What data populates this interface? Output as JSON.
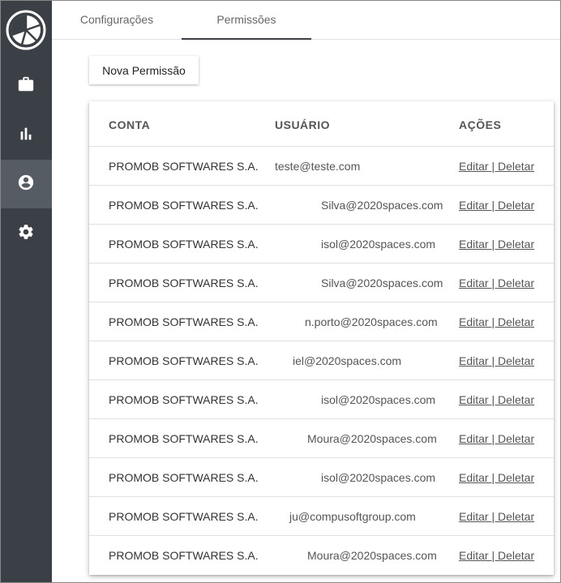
{
  "sidebar": {
    "logo": "citrus-slice-logo",
    "items": [
      {
        "icon": "briefcase-icon",
        "active": false
      },
      {
        "icon": "bar-chart-icon",
        "active": false
      },
      {
        "icon": "account-circle-icon",
        "active": true
      },
      {
        "icon": "gear-icon",
        "active": false
      }
    ],
    "colors": {
      "background": "#3b4046",
      "active": "#555c64",
      "icon": "#ffffff"
    }
  },
  "tabs": [
    {
      "label": "Configurações",
      "active": false
    },
    {
      "label": "Permissões",
      "active": true
    }
  ],
  "new_permission_label": "Nova Permissão",
  "table": {
    "headers": {
      "conta": "CONTA",
      "usuario": "USUÁRIO",
      "acoes": "AÇÕES"
    },
    "edit_label": "Editar",
    "separator": " | ",
    "delete_label": "Deletar",
    "rows": [
      {
        "conta": "PROMOB SOFTWARES S.A.",
        "usuario": "teste@teste.com"
      },
      {
        "conta": "PROMOB SOFTWARES S.A.",
        "usuario": "Silva@2020spaces.com"
      },
      {
        "conta": "PROMOB SOFTWARES S.A.",
        "usuario": "isol@2020spaces.com"
      },
      {
        "conta": "PROMOB SOFTWARES S.A.",
        "usuario": "Silva@2020spaces.com"
      },
      {
        "conta": "PROMOB SOFTWARES S.A.",
        "usuario": "n.porto@2020spaces.com"
      },
      {
        "conta": "PROMOB SOFTWARES S.A.",
        "usuario": "iel@2020spaces.com"
      },
      {
        "conta": "PROMOB SOFTWARES S.A.",
        "usuario": "isol@2020spaces.com"
      },
      {
        "conta": "PROMOB SOFTWARES S.A.",
        "usuario": "Moura@2020spaces.com"
      },
      {
        "conta": "PROMOB SOFTWARES S.A.",
        "usuario": "isol@2020spaces.com"
      },
      {
        "conta": "PROMOB SOFTWARES S.A.",
        "usuario": "ju@compusoftgroup.com"
      },
      {
        "conta": "PROMOB SOFTWARES S.A.",
        "usuario": "Moura@2020spaces.com"
      }
    ]
  }
}
